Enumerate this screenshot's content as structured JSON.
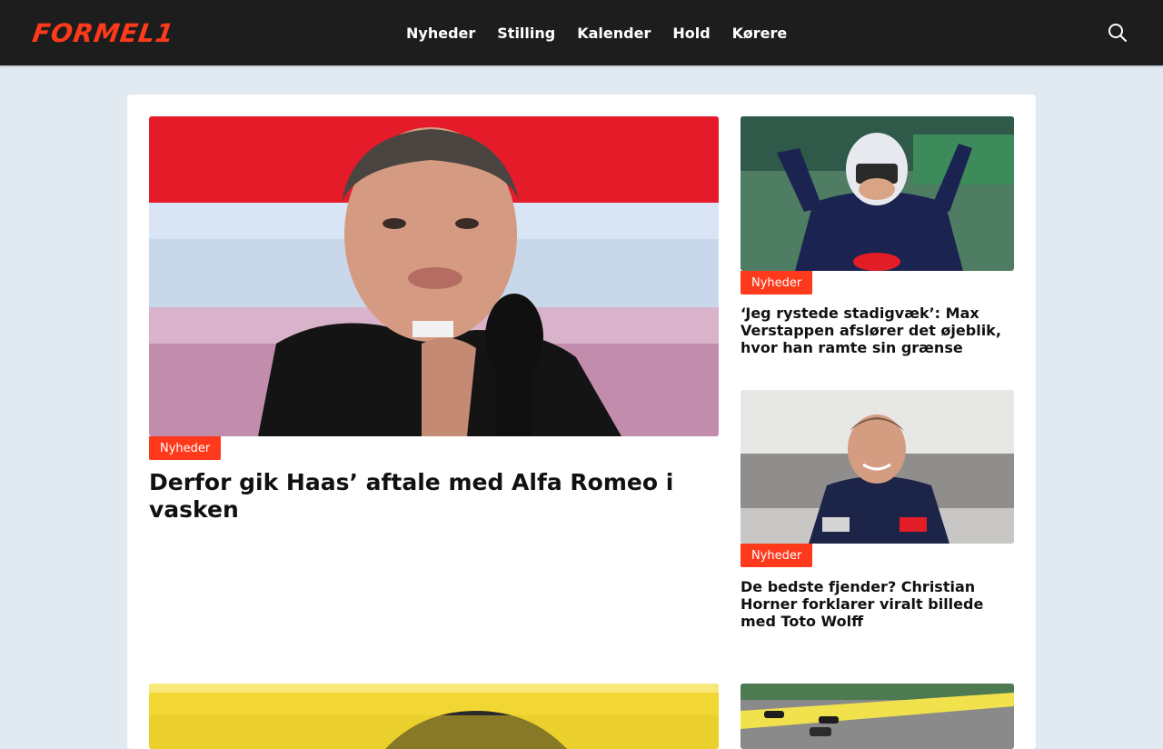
{
  "header": {
    "logo_text": "FORMEL1",
    "nav": [
      "Nyheder",
      "Stilling",
      "Kalender",
      "Hold",
      "Kørere"
    ],
    "search_icon": "search-icon"
  },
  "colors": {
    "header_bg": "#1d1d1d",
    "accent": "#ff3a1c",
    "page_bg": "#e1e9f1",
    "card_bg": "#ffffff"
  },
  "articles": [
    {
      "category": "Nyheder",
      "title": "Derfor gik Haas’ aftale med Alfa Romeo i vasken"
    },
    {
      "category": "Nyheder",
      "title": "‘Jeg rystede stadigvæk’: Max Verstappen afslører det øjeblik, hvor han ramte sin grænse"
    },
    {
      "category": "Nyheder",
      "title": "De bedste fjender? Christian Horner forklarer viralt billede med Toto Wolff"
    }
  ]
}
